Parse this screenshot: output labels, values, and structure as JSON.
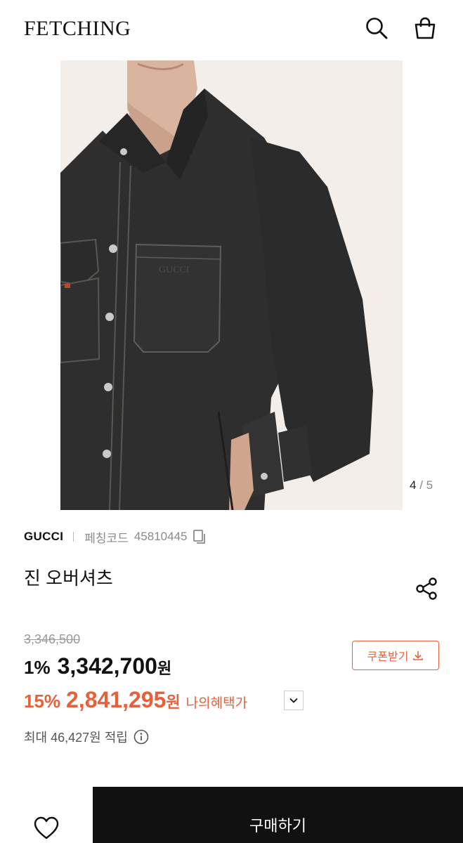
{
  "header": {
    "logo": "FETCHING",
    "search_icon": "search-icon",
    "bag_icon": "shopping-bag-icon"
  },
  "gallery": {
    "current": "4",
    "separator": "/",
    "total": "5"
  },
  "product": {
    "brand": "GUCCI",
    "code_label": "페칭코드",
    "code": "45810445",
    "name": "진 오버셔츠"
  },
  "pricing": {
    "original_price": "3,346,500",
    "discount_percent": "1%",
    "sale_price": "3,342,700",
    "currency": "원",
    "benefit_percent": "15%",
    "benefit_price": "2,841,295",
    "benefit_label": "나의혜택가",
    "coupon_label": "쿠폰받기",
    "points_text": "최대 46,427원 적립"
  },
  "bottom_bar": {
    "buy_label": "구매하기"
  },
  "colors": {
    "accent": "#e8603a",
    "text": "#111111",
    "muted": "#8a8a8a"
  }
}
